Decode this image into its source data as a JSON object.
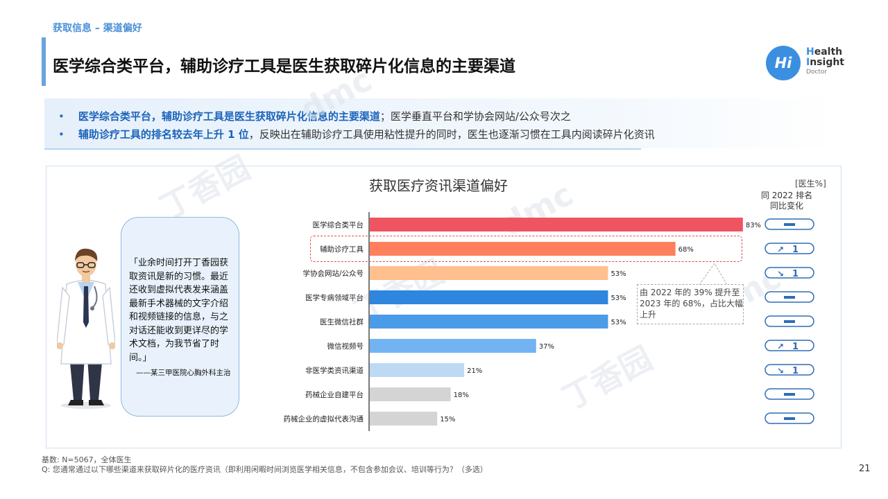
{
  "header": {
    "section": "获取信息 – 渠道偏好",
    "title": "医学综合类平台，辅助诊疗工具是医生获取碎片化信息的主要渠道"
  },
  "logo": {
    "mark": "Hi",
    "line1_first": "H",
    "line1_rest": "ealth",
    "line2_first": "I",
    "line2_rest": "nsight",
    "line3": "Doctor"
  },
  "summary": {
    "bullet_symbol": "•",
    "b1_bold": "医学综合类平台，辅助诊疗工具是医生获取碎片化信息的主要渠道",
    "b1_rest": "；医学垂直平台和学协会网站/公众号次之",
    "b2_bold": "辅助诊疗工具的排名较去年上升 1 位",
    "b2_rest": "，反映出在辅助诊疗工具使用粘性提升的同时，医生也逐渐习惯在工具内阅读碎片化资讯"
  },
  "watermarks": {
    "brand": "dmc",
    "cn": "丁香园"
  },
  "quote": {
    "text": "「业余时间打开丁香园获取资讯是新的习惯。最近还收到虚拟代表发来涵盖最新手术器械的文字介绍和视频链接的信息，与之对话还能收到更详尽的学术文档，为我节省了时间。」",
    "attribution": "——某三甲医院心胸外科主治"
  },
  "chart_labels": {
    "unit": "[医生%]",
    "rank_line1": "同 2022 排名",
    "rank_line2": "同比变化",
    "annotation": "由 2022 年的 39% 提升至 2023 年的 68%，占比大幅上升"
  },
  "chart_data": {
    "type": "bar",
    "orientation": "horizontal",
    "title": "获取医疗资讯渠道偏好",
    "categories": [
      "医学综合类平台",
      "辅助诊疗工具",
      "学协会网站/公众号",
      "医学专病领域平台",
      "医生微信社群",
      "微信视频号",
      "非医学类资讯渠道",
      "药械企业自建平台",
      "药械企业的虚拟代表沟通"
    ],
    "values": [
      83,
      68,
      53,
      53,
      53,
      37,
      21,
      18,
      15
    ],
    "value_suffix": "%",
    "xlim": [
      0,
      100
    ],
    "bar_colors": [
      "#ef5461",
      "#ff7f5c",
      "#ffbf8e",
      "#2e86de",
      "#4a9be8",
      "#72b4f2",
      "#bdd9f4",
      "#d4d4d4",
      "#d4d4d4"
    ],
    "rank_change": [
      {
        "dir": "same",
        "value": ""
      },
      {
        "dir": "up",
        "value": "1"
      },
      {
        "dir": "down",
        "value": "1"
      },
      {
        "dir": "same",
        "value": ""
      },
      {
        "dir": "same",
        "value": ""
      },
      {
        "dir": "up",
        "value": "1"
      },
      {
        "dir": "down",
        "value": "1"
      },
      {
        "dir": "same",
        "value": ""
      },
      {
        "dir": "same",
        "value": ""
      }
    ],
    "highlight_category": "辅助诊疗工具",
    "grid": false
  },
  "footer": {
    "base": "基数:  N=5067，全体医生",
    "question": "Q:  您通常通过以下哪些渠道来获取碎片化的医疗资讯（即利用闲暇时间浏览医学相关信息，不包含参加会议、培训等行为？（多选）"
  },
  "page_number": "21"
}
